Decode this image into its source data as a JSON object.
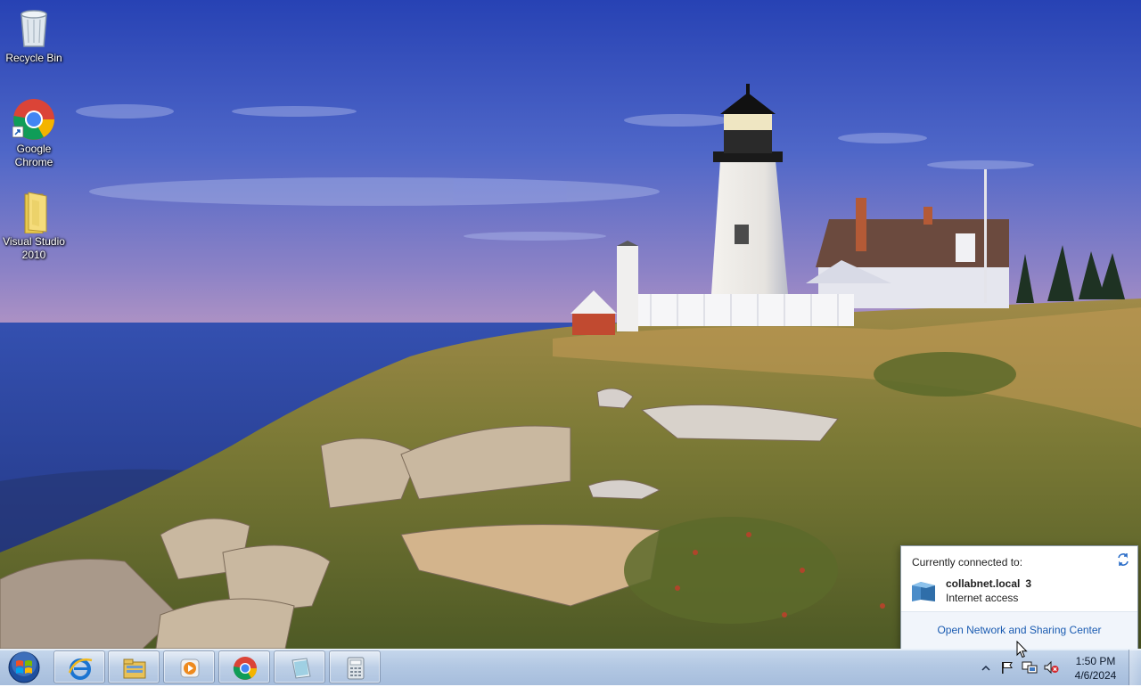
{
  "desktop": {
    "icons": [
      {
        "label": "Recycle Bin",
        "icon": "recycle-bin-icon"
      },
      {
        "label": "Google Chrome",
        "icon": "chrome-icon"
      },
      {
        "label": "Visual Studio 2010",
        "icon": "folder-icon"
      }
    ]
  },
  "network_popup": {
    "heading": "Currently connected to:",
    "connection_name": "collabnet.local",
    "connection_number": "3",
    "connection_status": "Internet access",
    "footer_link": "Open Network and Sharing Center"
  },
  "taskbar": {
    "pinned": [
      {
        "name": "internet-explorer",
        "icon": "internet-explorer-icon"
      },
      {
        "name": "windows-explorer",
        "icon": "file-explorer-icon"
      },
      {
        "name": "media-player",
        "icon": "media-player-icon"
      },
      {
        "name": "google-chrome",
        "icon": "chrome-icon"
      },
      {
        "name": "notepad",
        "icon": "notepad-icon"
      },
      {
        "name": "calculator",
        "icon": "calculator-icon"
      }
    ],
    "clock": {
      "time": "1:50 PM",
      "date": "4/6/2024"
    }
  },
  "colors": {
    "sky_top": "#2f4bb7",
    "sea": "#2c46a8",
    "grass": "#7f7b3a",
    "taskbar": "#b3c8e3",
    "link": "#1a5bb1"
  }
}
